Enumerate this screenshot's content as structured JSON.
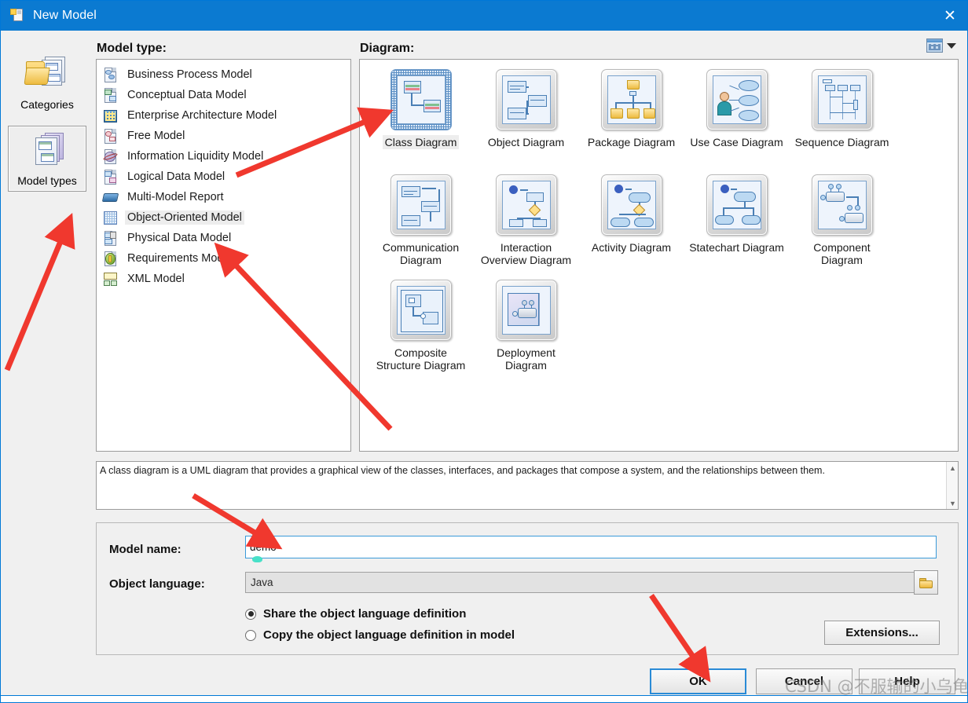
{
  "window": {
    "title": "New Model",
    "icon": "new-model-icon",
    "close_label": "✕"
  },
  "rail": {
    "items": [
      {
        "id": "categories",
        "label": "Categories",
        "icon": "folder-documents-icon",
        "selected": false
      },
      {
        "id": "model-types",
        "label": "Model types",
        "icon": "stacked-documents-icon",
        "selected": true
      }
    ]
  },
  "headings": {
    "model_type": "Model type:",
    "diagram": "Diagram:"
  },
  "view_toggle": {
    "icon": "grid-view-icon",
    "caret": "chevron-down-icon"
  },
  "model_types": [
    {
      "label": "Business Process Model",
      "icon": "business-process-icon",
      "selected": false
    },
    {
      "label": "Conceptual Data Model",
      "icon": "conceptual-data-icon",
      "selected": false
    },
    {
      "label": "Enterprise Architecture Model",
      "icon": "enterprise-architecture-icon",
      "selected": false
    },
    {
      "label": "Free Model",
      "icon": "free-model-icon",
      "selected": false
    },
    {
      "label": "Information Liquidity Model",
      "icon": "information-liquidity-icon",
      "selected": false
    },
    {
      "label": "Logical Data Model",
      "icon": "logical-data-icon",
      "selected": false
    },
    {
      "label": "Multi-Model Report",
      "icon": "multi-model-report-icon",
      "selected": false
    },
    {
      "label": "Object-Oriented Model",
      "icon": "object-oriented-icon",
      "selected": true
    },
    {
      "label": "Physical Data Model",
      "icon": "physical-data-icon",
      "selected": false
    },
    {
      "label": "Requirements Model",
      "icon": "requirements-icon",
      "selected": false
    },
    {
      "label": "XML Model",
      "icon": "xml-model-icon",
      "selected": false
    }
  ],
  "diagrams": [
    {
      "label": "Class Diagram",
      "icon": "class-diagram-icon",
      "selected": true
    },
    {
      "label": "Object Diagram",
      "icon": "object-diagram-icon",
      "selected": false
    },
    {
      "label": "Package Diagram",
      "icon": "package-diagram-icon",
      "selected": false
    },
    {
      "label": "Use Case Diagram",
      "icon": "use-case-diagram-icon",
      "selected": false
    },
    {
      "label": "Sequence Diagram",
      "icon": "sequence-diagram-icon",
      "selected": false
    },
    {
      "label": "Communication Diagram",
      "icon": "communication-diagram-icon",
      "selected": false
    },
    {
      "label": "Interaction Overview Diagram",
      "icon": "interaction-overview-diagram-icon",
      "selected": false
    },
    {
      "label": "Activity Diagram",
      "icon": "activity-diagram-icon",
      "selected": false
    },
    {
      "label": "Statechart Diagram",
      "icon": "statechart-diagram-icon",
      "selected": false
    },
    {
      "label": "Component Diagram",
      "icon": "component-diagram-icon",
      "selected": false
    },
    {
      "label": "Composite Structure Diagram",
      "icon": "composite-structure-diagram-icon",
      "selected": false
    },
    {
      "label": "Deployment Diagram",
      "icon": "deployment-diagram-icon",
      "selected": false
    }
  ],
  "description": {
    "text": "A class diagram is a UML diagram that provides a graphical view of the classes, interfaces, and packages that compose a system, and the relationships between them.",
    "scroll_up": "▲",
    "scroll_down": "▼"
  },
  "form": {
    "model_name_label": "Model name:",
    "model_name_value": "demo",
    "model_name_placeholder": "",
    "object_language_label": "Object language:",
    "object_language_value": "Java",
    "browse_icon": "folder-icon",
    "radio_share_label": "Share the object language definition",
    "radio_copy_label": "Copy the object language definition in model",
    "radio_selected": "share",
    "extensions_label": "Extensions..."
  },
  "buttons": {
    "ok": "OK",
    "cancel": "Cancel",
    "help": "Help"
  },
  "watermark": "CSDN @不服输的小乌龟",
  "colors": {
    "titlebar": "#0b7ad1",
    "accent": "#2a8bd6",
    "annotation_arrow": "#f0382e",
    "selection_handle": "#48e0c8",
    "dialog_bg": "#f0f0f0"
  }
}
